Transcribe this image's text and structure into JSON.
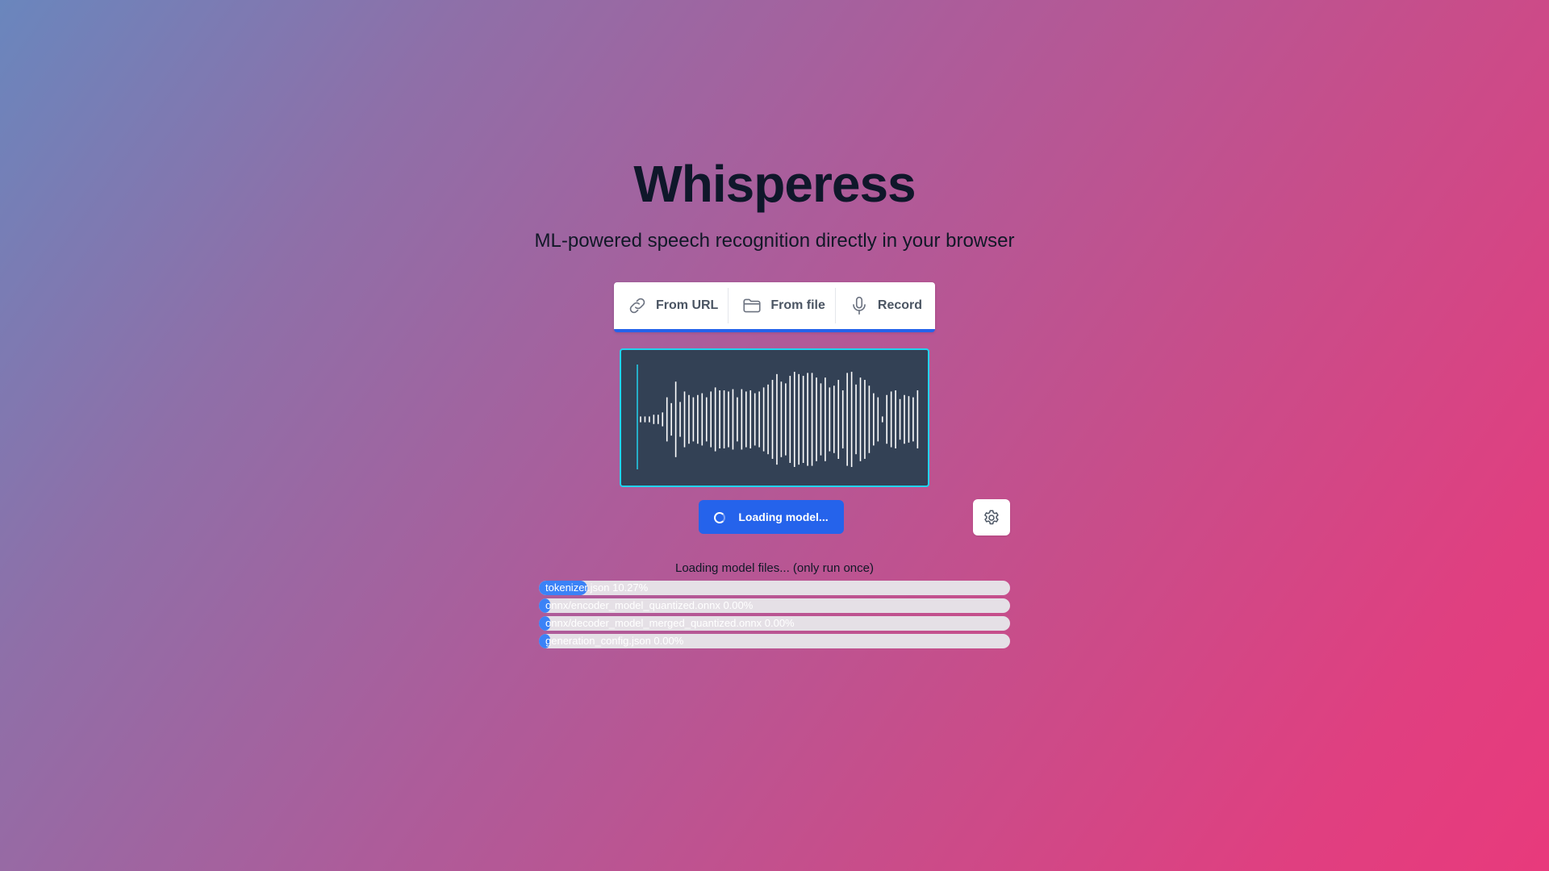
{
  "app": {
    "title": "Whisperess",
    "subtitle": "ML-powered speech recognition directly in your browser"
  },
  "source_bar": {
    "items": [
      {
        "label": "From URL",
        "icon": "link-icon"
      },
      {
        "label": "From file",
        "icon": "folder-icon"
      },
      {
        "label": "Record",
        "icon": "microphone-icon"
      }
    ],
    "accent": "#2563eb"
  },
  "waveform": {
    "background": "#334155",
    "border_color": "#22d3ee",
    "amplitudes": [
      0.05,
      0.05,
      0.05,
      0.08,
      0.08,
      0.12,
      0.38,
      0.28,
      0.65,
      0.3,
      0.48,
      0.42,
      0.38,
      0.42,
      0.45,
      0.38,
      0.48,
      0.55,
      0.5,
      0.5,
      0.48,
      0.52,
      0.38,
      0.52,
      0.48,
      0.5,
      0.45,
      0.48,
      0.55,
      0.6,
      0.68,
      0.78,
      0.65,
      0.62,
      0.75,
      0.82,
      0.78,
      0.75,
      0.8,
      0.8,
      0.72,
      0.62,
      0.72,
      0.55,
      0.58,
      0.68,
      0.5,
      0.8,
      0.82,
      0.6,
      0.72,
      0.68,
      0.58,
      0.45,
      0.38,
      0.05,
      0.42,
      0.48,
      0.5,
      0.35,
      0.42,
      0.4,
      0.38,
      0.5
    ]
  },
  "controls": {
    "load_label": "Loading model...",
    "settings_icon": "gear-icon",
    "button_color": "#2563eb"
  },
  "progress": {
    "heading": "Loading model files... (only run once)",
    "items": [
      {
        "label": "tokenizer.json 10.27%",
        "percent": 10.27
      },
      {
        "label": "onnx/encoder_model_quantized.onnx 0.00%",
        "percent": 0.0
      },
      {
        "label": "onnx/decoder_model_merged_quantized.onnx 0.00%",
        "percent": 0.0
      },
      {
        "label": "generation_config.json 0.00%",
        "percent": 0.0
      }
    ],
    "fill_color": "#3b82f6"
  }
}
